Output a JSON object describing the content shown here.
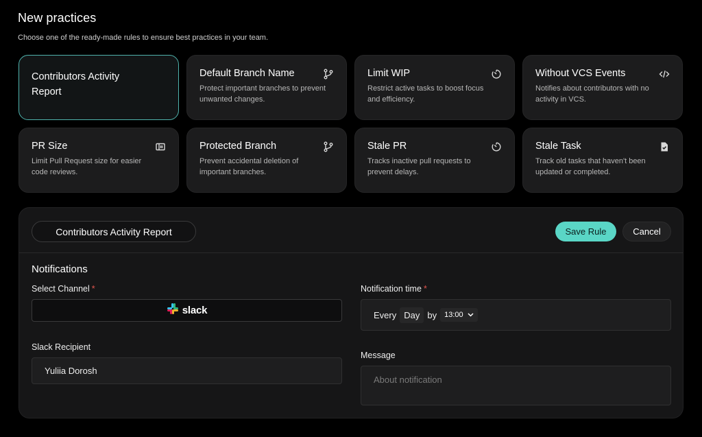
{
  "header": {
    "title": "New practices",
    "subtitle": "Choose one of the ready-made rules to ensure best practices in your team."
  },
  "practices": [
    {
      "title": "Contributors Activity Report",
      "description": "",
      "icon": ""
    },
    {
      "title": "Default Branch Name",
      "description": "Protect important branches to prevent unwanted changes.",
      "icon": "git-branch-icon"
    },
    {
      "title": "Limit WIP",
      "description": "Restrict active tasks to boost focus and efficiency.",
      "icon": "timer-icon"
    },
    {
      "title": "Without VCS Events",
      "description": "Notifies about contributors with no activity in VCS.",
      "icon": "code-icon"
    },
    {
      "title": "PR Size",
      "description": "Limit Pull Request size for easier code reviews.",
      "icon": "resize-icon"
    },
    {
      "title": "Protected Branch",
      "description": "Prevent accidental deletion of important branches.",
      "icon": "git-branch-icon"
    },
    {
      "title": "Stale PR",
      "description": "Tracks inactive pull requests to prevent delays.",
      "icon": "timer-icon"
    },
    {
      "title": "Stale Task",
      "description": "Track old tasks that haven't been updated or completed.",
      "icon": "file-check-icon"
    }
  ],
  "editor": {
    "rule_name": "Contributors Activity Report",
    "save_label": "Save Rule",
    "cancel_label": "Cancel",
    "section_title": "Notifications",
    "channel_label": "Select Channel",
    "channel_value": "slack",
    "recipient_label": "Slack Recipient",
    "recipient_value": "Yuliia Dorosh",
    "time_label": "Notification time",
    "time_every": "Every",
    "time_period": "Day",
    "time_by": "by",
    "time_value": "13:00",
    "message_label": "Message",
    "message_placeholder": "About notification",
    "required_mark": "*"
  },
  "colors": {
    "accent": "#5ad6c6",
    "selected_border": "#4fb3ad",
    "required": "#e0554e"
  }
}
